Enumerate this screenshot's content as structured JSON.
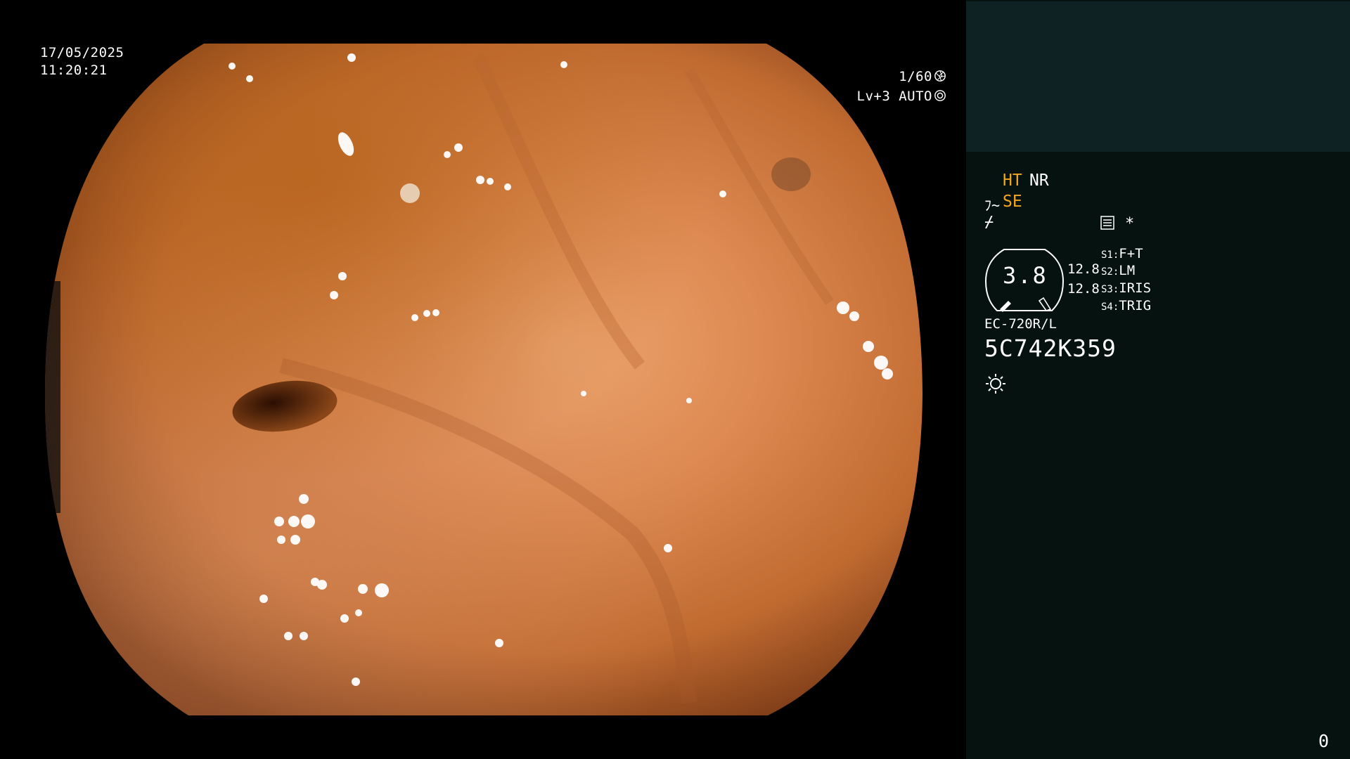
{
  "overlay": {
    "date": "17/05/2025",
    "time": "11:20:21",
    "shutter": "1/60",
    "level": "Lv+3 AUTO"
  },
  "settings": {
    "ht": "HT",
    "nr": "NR",
    "se": "SE",
    "star": "*",
    "dial_value": "3.8",
    "value_1": "12.8",
    "value_2": "12.8",
    "switches": [
      {
        "key": "S1",
        "value": "F+T"
      },
      {
        "key": "S2",
        "value": "LM"
      },
      {
        "key": "S3",
        "value": "IRIS"
      },
      {
        "key": "S4",
        "value": "TRIG"
      }
    ],
    "scope_model": "EC-720R/L",
    "scope_serial": "5C742K359",
    "counter": "0"
  },
  "colors": {
    "highlight": "#f2a623",
    "panel_bg": "#061210",
    "panel_top_bg": "#0e2224",
    "mucosa": "#d07a45"
  },
  "icons": [
    "aperture-icon",
    "gear-icon",
    "scope-icon",
    "flash-icon",
    "menu-icon",
    "light-icon"
  ]
}
